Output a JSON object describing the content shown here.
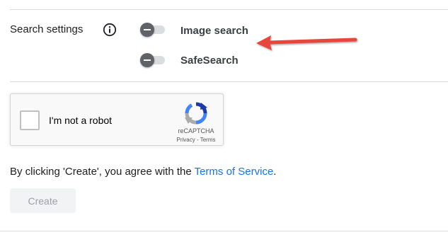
{
  "search_settings": {
    "label": "Search settings",
    "info_icon": "info-circle-icon",
    "toggles": [
      {
        "label": "Image search",
        "state": "off"
      },
      {
        "label": "SafeSearch",
        "state": "off"
      }
    ]
  },
  "annotation": {
    "arrow_color": "#e8453c",
    "icon": "red-arrow-left"
  },
  "recaptcha": {
    "checkbox_label": "I'm not a robot",
    "brand": "reCAPTCHA",
    "privacy_link": "Privacy",
    "separator": " - ",
    "terms_link": "Terms"
  },
  "agreement": {
    "prefix": "By clicking 'Create', you agree with the ",
    "link": "Terms of Service",
    "suffix": "."
  },
  "create_button": {
    "label": "Create",
    "enabled": false
  },
  "colors": {
    "link": "#1a73e8",
    "toggle_knob": "#5f6368",
    "arrow": "#e8453c"
  }
}
